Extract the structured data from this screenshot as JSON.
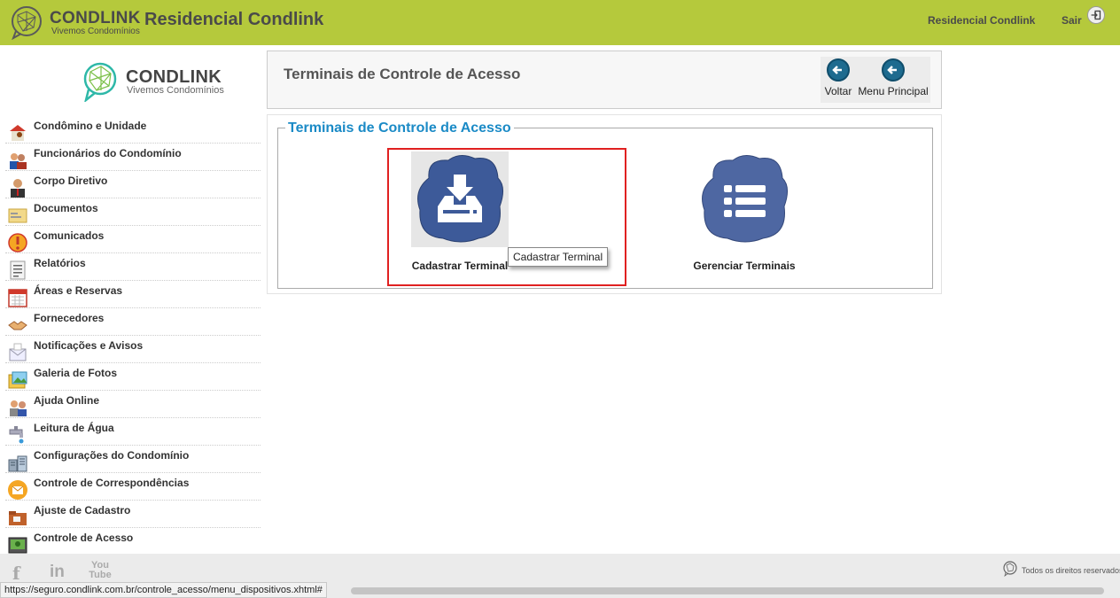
{
  "header": {
    "brand": "CONDLINK",
    "tagline": "Vivemos Condomínios",
    "site_title": "Residencial Condlink",
    "user_link": "Residencial Condlink",
    "exit_label": "Sair"
  },
  "sidebar": {
    "brand": "CONDLINK",
    "tagline": "Vivemos Condomínios",
    "items": [
      {
        "label": "Condômino e Unidade",
        "icon": "resident-unit-icon"
      },
      {
        "label": "Funcionários do Condomínio",
        "icon": "staff-icon"
      },
      {
        "label": "Corpo Diretivo",
        "icon": "board-icon"
      },
      {
        "label": "Documentos",
        "icon": "documents-icon"
      },
      {
        "label": "Comunicados",
        "icon": "alert-icon"
      },
      {
        "label": "Relatórios",
        "icon": "reports-icon"
      },
      {
        "label": "Áreas e Reservas",
        "icon": "calendar-icon"
      },
      {
        "label": "Fornecedores",
        "icon": "handshake-icon"
      },
      {
        "label": "Notificações e Avisos",
        "icon": "notifications-icon"
      },
      {
        "label": "Galeria de Fotos",
        "icon": "photos-icon"
      },
      {
        "label": "Ajuda Online",
        "icon": "help-icon"
      },
      {
        "label": "Leitura de Água",
        "icon": "water-tap-icon"
      },
      {
        "label": "Configurações do Condomínio",
        "icon": "building-settings-icon"
      },
      {
        "label": "Controle de Correspondências",
        "icon": "mail-icon"
      },
      {
        "label": "Ajuste de Cadastro",
        "icon": "folder-icon"
      },
      {
        "label": "Controle de Acesso",
        "icon": "access-control-icon"
      }
    ]
  },
  "page": {
    "title": "Terminais de Controle de Acesso",
    "back_label": "Voltar",
    "main_menu_label": "Menu Principal",
    "section_legend": "Terminais de Controle de Acesso",
    "tiles": [
      {
        "label": "Cadastrar Terminal",
        "icon": "download-cloud-icon"
      },
      {
        "label": "Gerenciar Terminais",
        "icon": "list-cloud-icon"
      }
    ],
    "tooltip": "Cadastrar Terminal"
  },
  "footer": {
    "social": [
      "f",
      "in",
      "You Tube"
    ],
    "rights": "Todos os direitos reservados"
  },
  "status_url": "https://seguro.condlink.com.br/controle_acesso/menu_dispositivos.xhtml#",
  "colors": {
    "header_bg": "#b5c93c",
    "accent_blue": "#1a8ac6",
    "tile_blue": "#3d5a99",
    "highlight_red": "#e02020"
  }
}
